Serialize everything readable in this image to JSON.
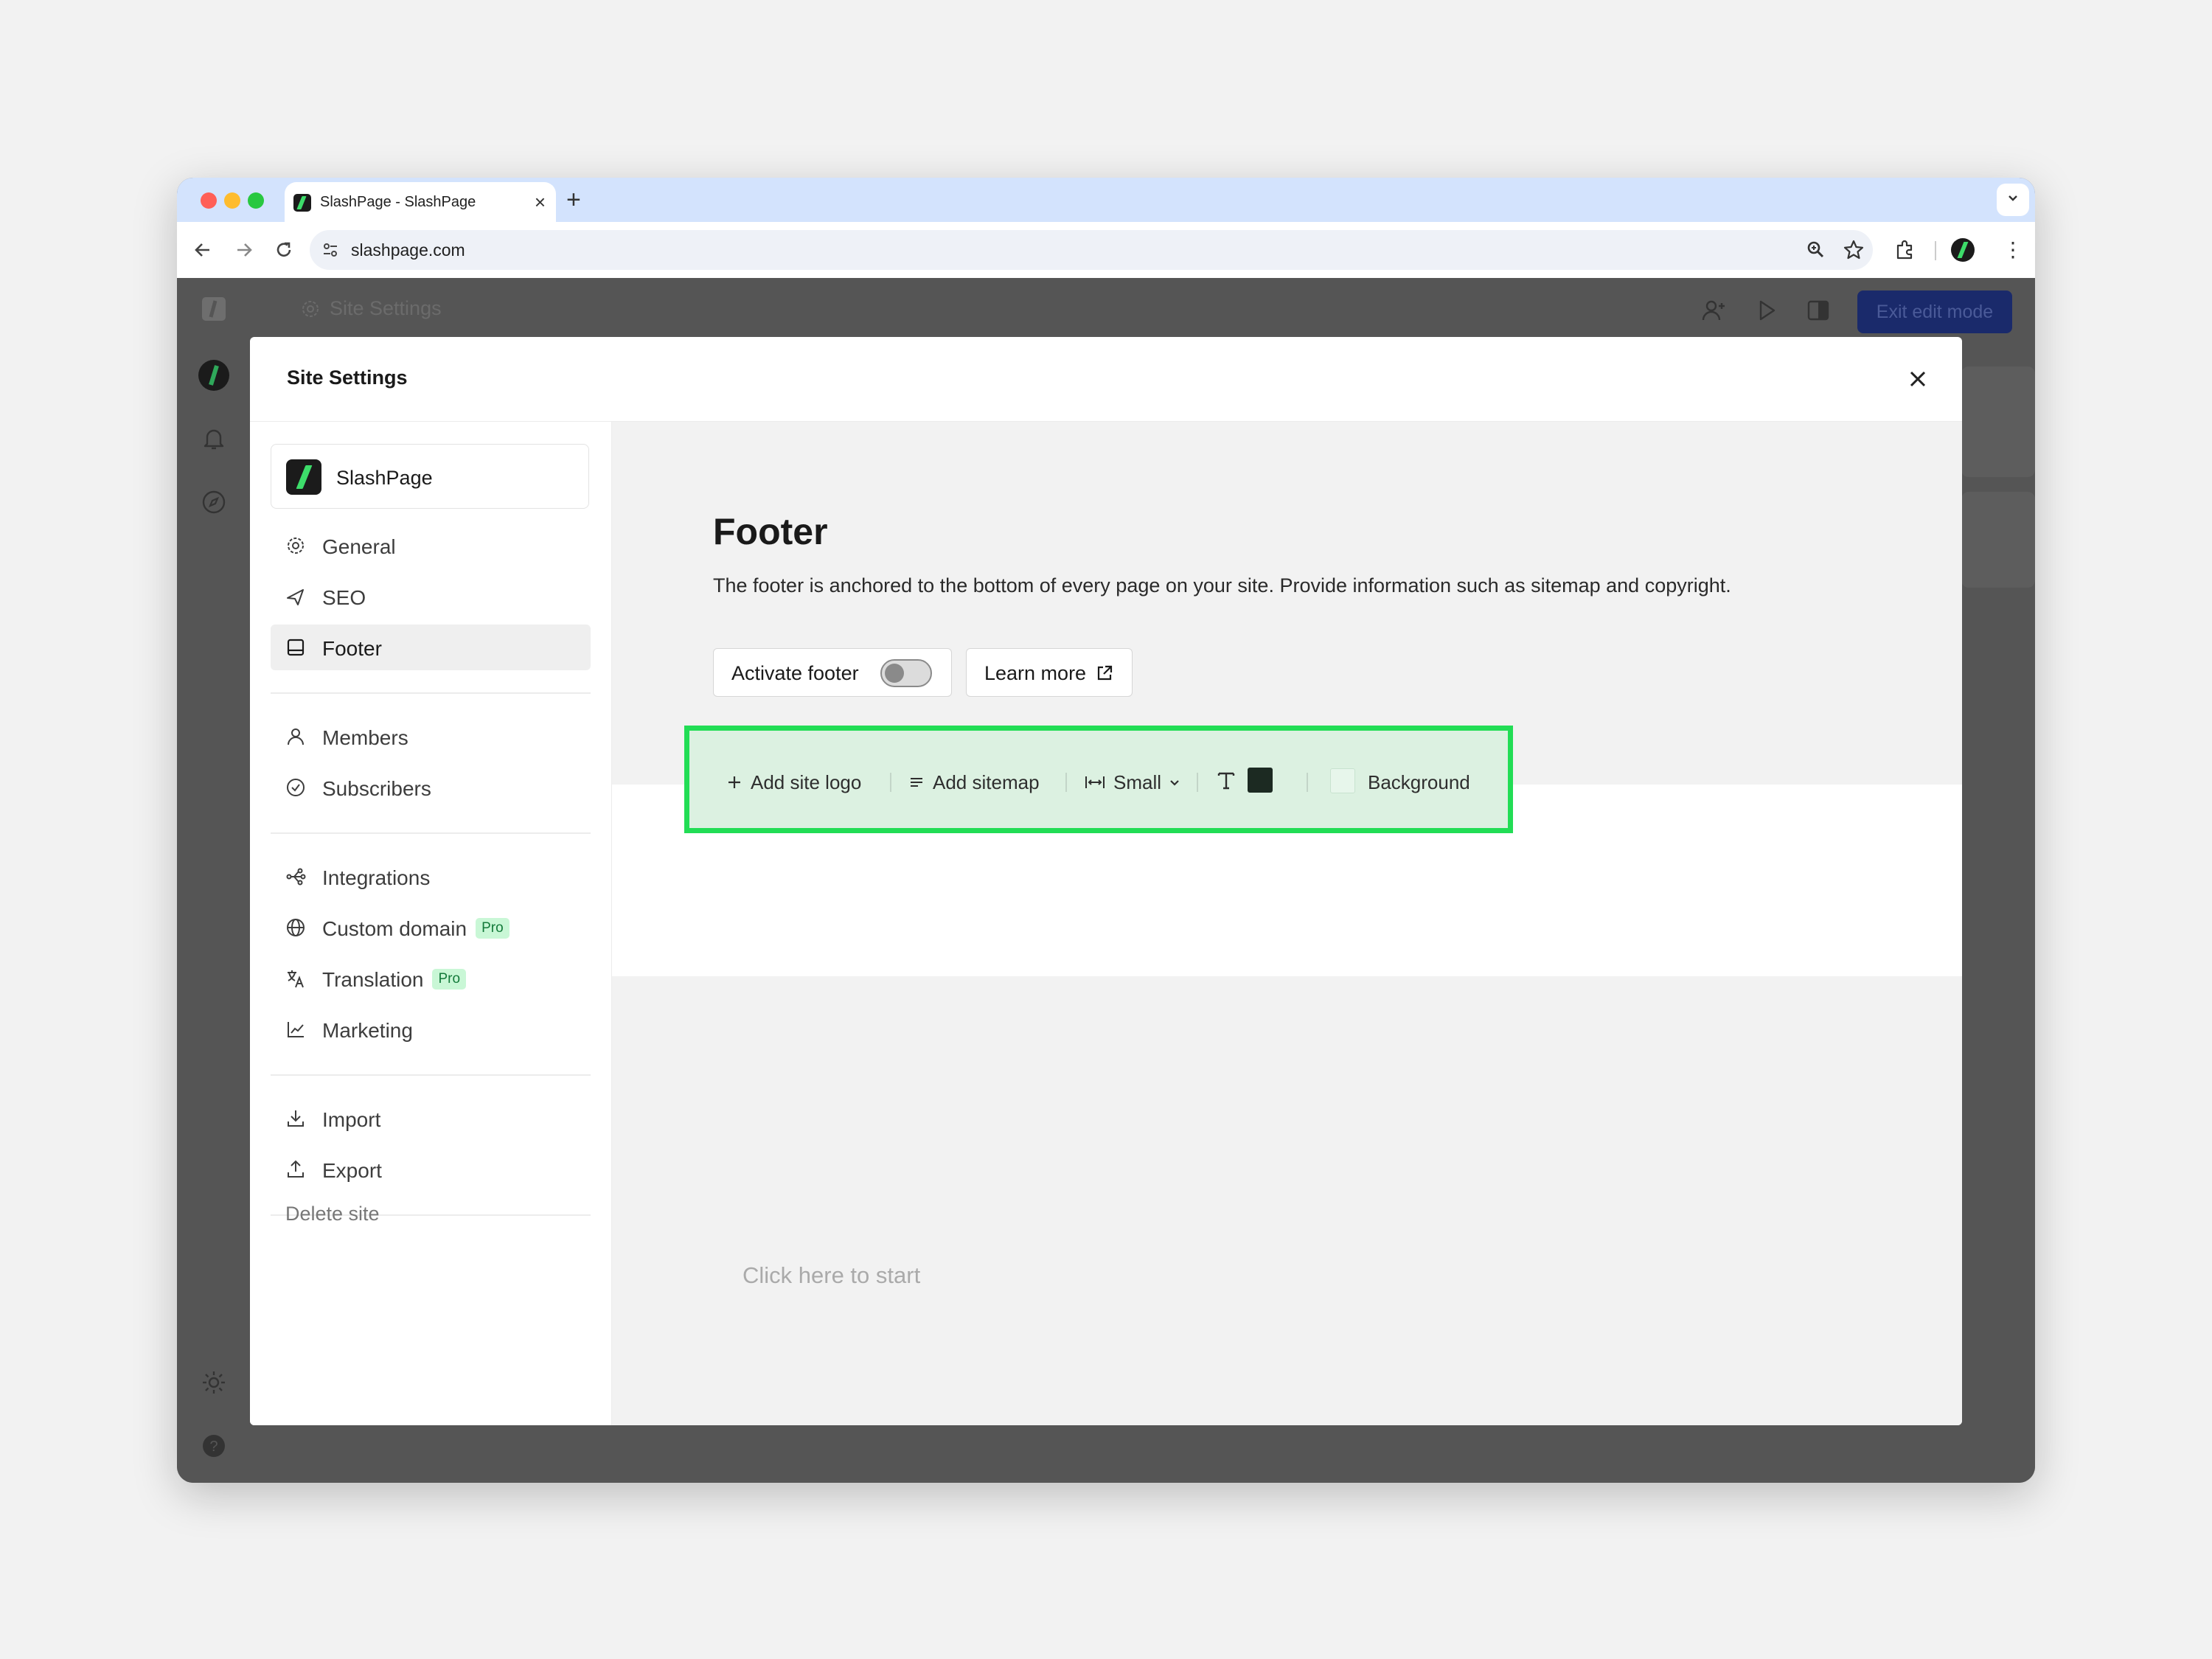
{
  "browser": {
    "tab_title": "SlashPage - SlashPage",
    "tab_close": "×",
    "new_tab": "+",
    "url": "slashpage.com",
    "traffic_colors": [
      "#ff5f57",
      "#febc2e",
      "#28c840"
    ]
  },
  "app": {
    "topbar_title": "Site Settings",
    "exit_edit_label": "Exit edit mode",
    "brand_color": "#3ddc6a"
  },
  "modal": {
    "title": "Site Settings",
    "site_name": "SlashPage",
    "nav": [
      {
        "label": "General",
        "icon": "gear-icon"
      },
      {
        "label": "SEO",
        "icon": "send-icon"
      },
      {
        "label": "Footer",
        "icon": "footer-layout-icon",
        "active": true
      },
      {
        "label": "Members",
        "icon": "person-icon"
      },
      {
        "label": "Subscribers",
        "icon": "check-circle-icon"
      },
      {
        "label": "Integrations",
        "icon": "integrations-icon"
      },
      {
        "label": "Custom domain",
        "icon": "globe-icon",
        "badge": "Pro"
      },
      {
        "label": "Translation",
        "icon": "translate-icon",
        "badge": "Pro"
      },
      {
        "label": "Marketing",
        "icon": "chart-line-icon"
      },
      {
        "label": "Import",
        "icon": "download-icon"
      },
      {
        "label": "Export",
        "icon": "upload-icon"
      }
    ],
    "delete_site": "Delete site"
  },
  "footer_settings": {
    "heading": "Footer",
    "description": "The footer is anchored to the bottom of every page on your site. Provide information such as sitemap and copyright.",
    "activate_label": "Activate footer",
    "activate_on": false,
    "learn_more": "Learn more",
    "toolbar": {
      "add_logo": "Add site logo",
      "add_sitemap": "Add sitemap",
      "size_value": "Small",
      "text_color": "#1c2a22",
      "background_label": "Background",
      "background_color": "#e7f6eb"
    },
    "placeholder": "Click here to start"
  }
}
